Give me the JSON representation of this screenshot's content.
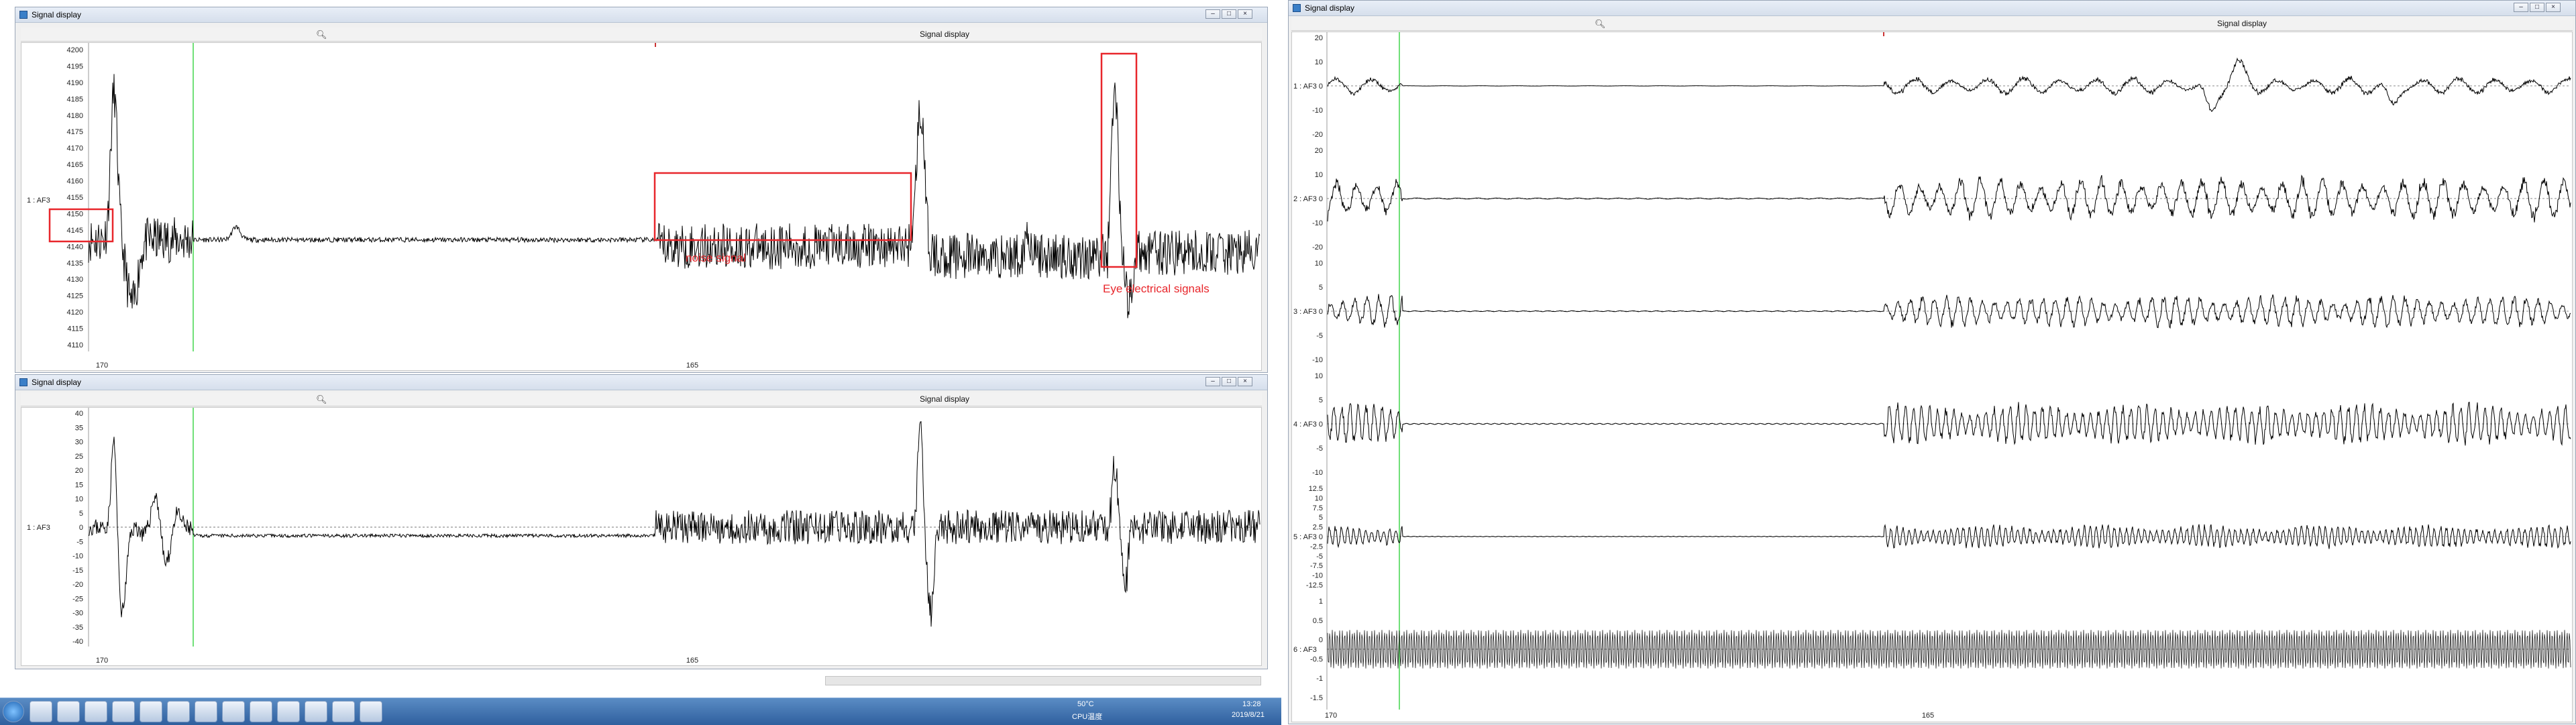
{
  "left_window": {
    "title": "Signal display",
    "top_panel": {
      "header_title": "Signal display",
      "channel_label": "1 : AF3",
      "y_ticks": [
        "4200",
        "4195",
        "4190",
        "4185",
        "4180",
        "4175",
        "4170",
        "4165",
        "4160",
        "4155",
        "4150",
        "4145",
        "4140",
        "4135",
        "4130",
        "4125",
        "4120",
        "4115",
        "4110"
      ],
      "x_ticks": [
        "170",
        "165"
      ],
      "annotations": [
        "noise signal",
        "Eye electrical signals"
      ]
    },
    "bottom_window_title": "Signal display",
    "bottom_panel": {
      "header_title": "Signal display",
      "channel_label": "1 : AF3",
      "y_ticks": [
        "40",
        "35",
        "30",
        "25",
        "20",
        "15",
        "10",
        "5",
        "0",
        "-5",
        "-10",
        "-15",
        "-20",
        "-25",
        "-30",
        "-35",
        "-40"
      ],
      "x_ticks": [
        "170",
        "165"
      ]
    }
  },
  "right_window": {
    "title": "Signal display",
    "header_title": "Signal display",
    "channels": [
      {
        "label": "1 : AF3",
        "ticks": [
          "20",
          "10",
          "0",
          "-10",
          "-20"
        ]
      },
      {
        "label": "2 : AF3",
        "ticks": [
          "20",
          "10",
          "0",
          "-10",
          "-20"
        ]
      },
      {
        "label": "3 : AF3",
        "ticks": [
          "10",
          "5",
          "0",
          "-5",
          "-10"
        ]
      },
      {
        "label": "4 : AF3",
        "ticks": [
          "10",
          "5",
          "0",
          "-5",
          "-10"
        ]
      },
      {
        "label": "5 : AF3",
        "ticks": [
          "12.5",
          "10",
          "7.5",
          "5",
          "2.5",
          "0",
          "-2.5",
          "-5",
          "-7.5",
          "-10",
          "-12.5"
        ]
      },
      {
        "label": "6 : AF3",
        "ticks": [
          "1",
          "0.5",
          "0",
          "-0.5",
          "-1",
          "-1.5"
        ]
      }
    ],
    "x_ticks": [
      "170",
      "165"
    ]
  },
  "taskbar": {
    "icons": [
      "start-orb",
      "file-explorer",
      "media-player",
      "browser",
      "spreadsheet",
      "game",
      "atr-tool",
      "refresh-tool",
      "ie-browser",
      "settings-tool",
      "word-doc",
      "terminal",
      "editor",
      "cube-app"
    ],
    "cpu_temp": "50°C",
    "cpu_label": "CPU温度",
    "time": "13:28",
    "date": "2019/8/21"
  },
  "colors": {
    "annotation": "#e8262b",
    "cursor": "#41d64b",
    "trace": "#000000"
  }
}
